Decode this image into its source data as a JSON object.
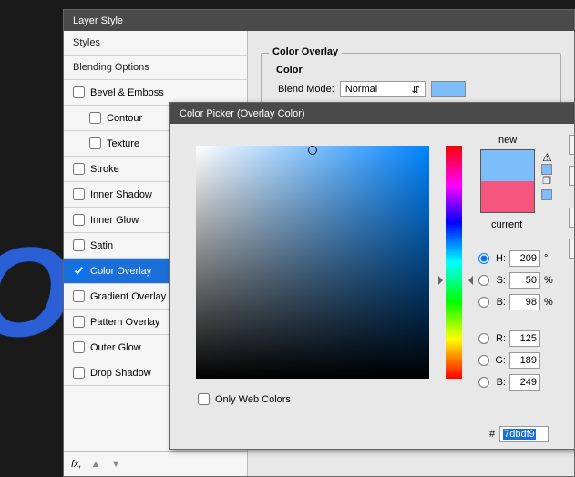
{
  "bg_text": "O",
  "layer_style": {
    "title": "Layer Style",
    "styles": [
      {
        "label": "Styles",
        "type": "header"
      },
      {
        "label": "Blending Options",
        "type": "header"
      },
      {
        "label": "Bevel & Emboss",
        "checked": false
      },
      {
        "label": "Contour",
        "checked": false,
        "indent": true
      },
      {
        "label": "Texture",
        "checked": false,
        "indent": true
      },
      {
        "label": "Stroke",
        "checked": false
      },
      {
        "label": "Inner Shadow",
        "checked": false
      },
      {
        "label": "Inner Glow",
        "checked": false
      },
      {
        "label": "Satin",
        "checked": false
      },
      {
        "label": "Color Overlay",
        "checked": true,
        "selected": true
      },
      {
        "label": "Gradient Overlay",
        "checked": false
      },
      {
        "label": "Pattern Overlay",
        "checked": false
      },
      {
        "label": "Outer Glow",
        "checked": false
      },
      {
        "label": "Drop Shadow",
        "checked": false
      }
    ],
    "fx_label": "fx,",
    "right_panel": {
      "group_title": "Color Overlay",
      "sub_title": "Color",
      "blend_mode_label": "Blend Mode:",
      "blend_mode_value": "Normal",
      "swatch_color": "#7dbdf9"
    }
  },
  "color_picker": {
    "title": "Color Picker (Overlay Color)",
    "new_label": "new",
    "current_label": "current",
    "new_color": "#7dbdf9",
    "current_color": "#f4567e",
    "only_web_label": "Only Web Colors",
    "only_web_checked": false,
    "warn_icon": "⚠",
    "cube_icon": "❒",
    "tiny_swatch1": "#7dbdf9",
    "tiny_swatch2": "#7dbdf9",
    "hsb": {
      "H": {
        "value": "209",
        "unit": "°",
        "selected": true
      },
      "S": {
        "value": "50",
        "unit": "%",
        "selected": false
      },
      "B": {
        "value": "98",
        "unit": "%",
        "selected": false
      }
    },
    "rgb": {
      "R": {
        "value": "125",
        "selected": false
      },
      "G": {
        "value": "189",
        "selected": false
      },
      "B": {
        "value": "249",
        "selected": false
      }
    },
    "hex_label": "#",
    "hex_value": "7dbdf9"
  }
}
